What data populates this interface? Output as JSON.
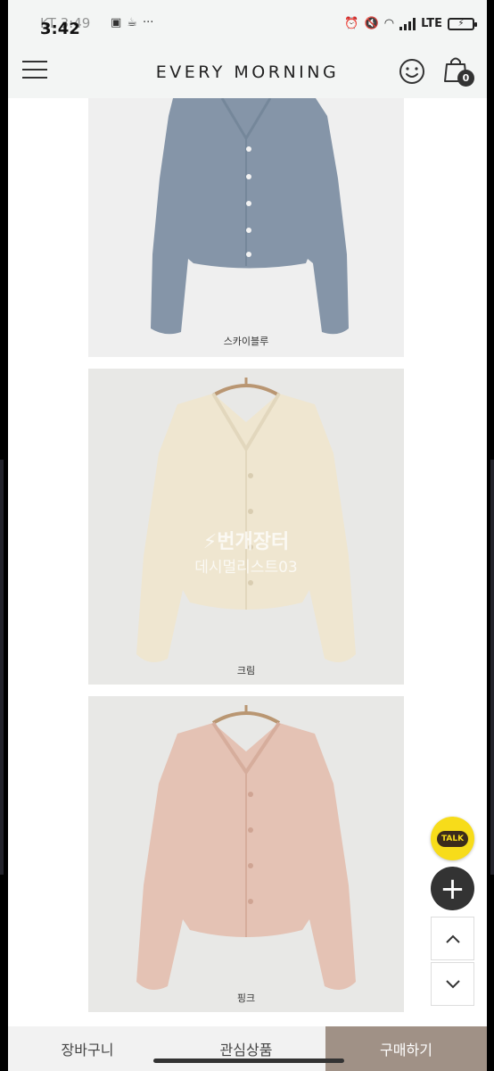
{
  "status_bar": {
    "time": "3:42",
    "carrier": "KT 3:49",
    "network": "LTE"
  },
  "header": {
    "brand": "EVERY MORNING",
    "cart_count": "0"
  },
  "products": [
    {
      "label": "스카이블루",
      "color": "#8595a8"
    },
    {
      "label": "크림",
      "color": "#efe6d0"
    },
    {
      "label": "핑크",
      "color": "#e4c2b4"
    }
  ],
  "watermark": {
    "logo": "⚡번개장터",
    "seller": "데시멀리스트03"
  },
  "floating": {
    "talk_label": "TALK"
  },
  "bottom_bar": {
    "cart": "장바구니",
    "wishlist": "관심상품",
    "buy": "구매하기"
  },
  "colors": {
    "accent": "#a09186",
    "kakao": "#f7dc1a"
  }
}
